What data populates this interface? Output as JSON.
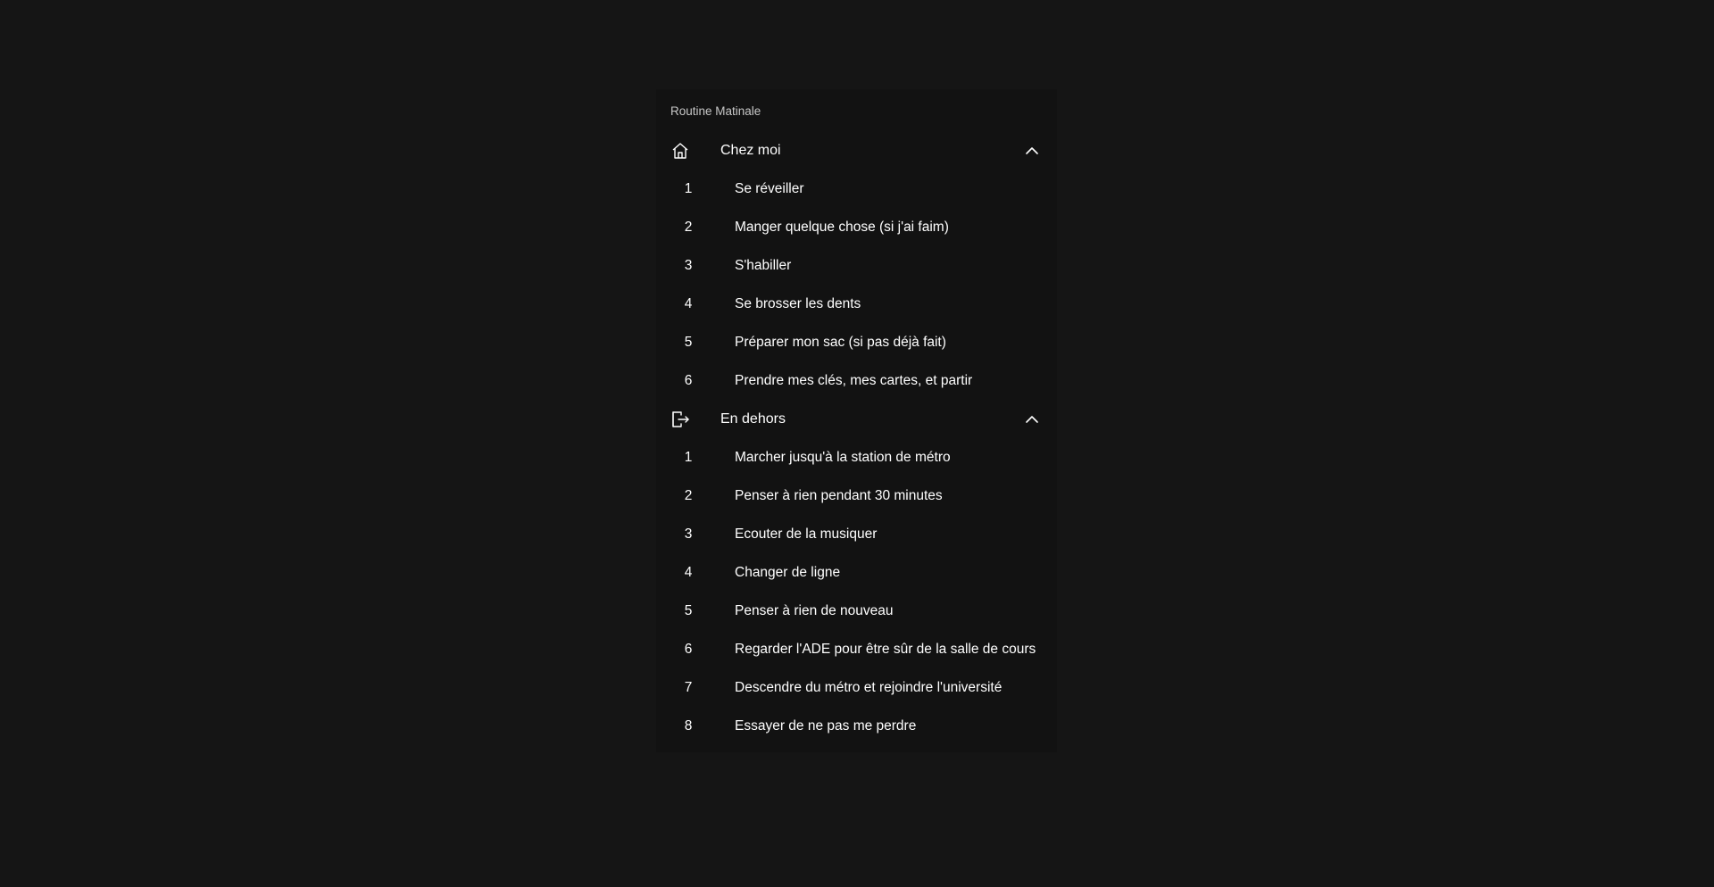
{
  "panel": {
    "title": "Routine Matinale"
  },
  "groups": [
    {
      "label": "Chez moi",
      "icon": "home-icon",
      "expanded": true,
      "items": [
        {
          "num": "1",
          "label": "Se réveiller"
        },
        {
          "num": "2",
          "label": "Manger quelque chose (si j'ai faim)"
        },
        {
          "num": "3",
          "label": "S'habiller"
        },
        {
          "num": "4",
          "label": "Se brosser les dents"
        },
        {
          "num": "5",
          "label": "Préparer mon sac (si pas déjà fait)"
        },
        {
          "num": "6",
          "label": "Prendre mes clés, mes cartes, et partir"
        }
      ]
    },
    {
      "label": "En dehors",
      "icon": "exit-icon",
      "expanded": true,
      "items": [
        {
          "num": "1",
          "label": "Marcher jusqu'à la station de métro"
        },
        {
          "num": "2",
          "label": "Penser à rien pendant 30 minutes"
        },
        {
          "num": "3",
          "label": "Ecouter de la musiquer"
        },
        {
          "num": "4",
          "label": "Changer de ligne"
        },
        {
          "num": "5",
          "label": "Penser à rien de nouveau"
        },
        {
          "num": "6",
          "label": "Regarder l'ADE pour être sûr de la salle de cours"
        },
        {
          "num": "7",
          "label": "Descendre du métro et rejoindre l'université"
        },
        {
          "num": "8",
          "label": "Essayer de ne pas me perdre"
        }
      ]
    }
  ],
  "colors": {
    "background": "#151515",
    "panel": "#121212",
    "text": "#ffffff",
    "title": "#c7c7c7"
  }
}
